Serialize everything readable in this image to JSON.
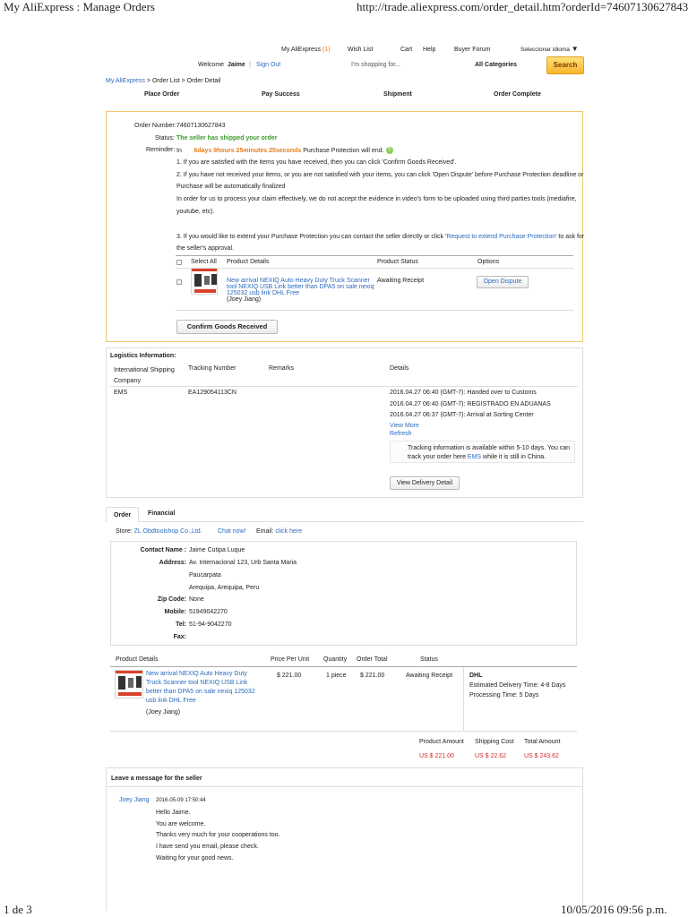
{
  "print": {
    "doc_title": "My AliExpress : Manage Orders",
    "url": "http://trade.aliexpress.com/order_detail.htm?orderId=74607130627843#...",
    "page": "1 de 3",
    "datetime": "10/05/2016 09:56 p.m."
  },
  "topnav": {
    "my_aliexpress": "My AliExpress",
    "count": "(1)",
    "wish_list": "Wish List",
    "cart": "Cart",
    "help": "Help",
    "buyer_forum": "Buyer Forum",
    "language": "Seleccionar idioma",
    "welcome": "Welcome",
    "user": "Jaime",
    "sign_out": "Sign Out",
    "search_placeholder": "I'm shopping for...",
    "categories": "All Categories",
    "search_btn": "Search"
  },
  "breadcrumb": {
    "root": "My AliExpress",
    "rest": " > Order List > Order Detail"
  },
  "steps": [
    "Place Order",
    "Pay Success",
    "Shipment",
    "Order Complete"
  ],
  "summary": {
    "order_number_label": "Order Number:",
    "order_number": "74607130627843",
    "status_label": "Status:",
    "status": "The seller has shipped your order",
    "reminder_label": "Reminder:",
    "reminder_in": "In",
    "countdown": "6days 9hours 25minutes 25seconds",
    "reminder_tail": "Purchase Protection will end.",
    "note1": "1. If you are satisfied with the items you have received, then you can click 'Confirm Goods Received'.",
    "note2a": "2. If you have not received your items, or you are not satisfied with your items, you can click 'Open Dispute' before Purchase Protection deadline or",
    "note2b": "Purchase will be automatically finalized",
    "note2c": "In order for us to process your claim effectively, we do not accept the evidence in video's form to be uploaded using third parties tools (mediafire,",
    "note2d": "youtube, etc).",
    "note3a": "3. If you would like to extend your Purchase Protection you can contact the seller directly or click '",
    "note3_link": "Request to extend Purchase Protection",
    "note3b": "' to ask for",
    "note3c": "the seller's approval.",
    "table": {
      "select_all": "Select All",
      "product_details": "Product Details",
      "product_status": "Product Status",
      "options": "Options"
    },
    "item": {
      "title1": "New arrival NEXIQ Auto Heavy Duty Truck Scanner",
      "title2": "tool NEXIQ USB Link better than DPA5 on sale nexiq",
      "title3": "125032 usb link DHL Free",
      "seller": "(Joey Jiang)",
      "status": "Awaiting Receipt",
      "dispute_btn": "Open Dispute"
    },
    "confirm_btn": "Confirm Goods Received"
  },
  "logistics": {
    "title": "Logistics Information:",
    "col_company1": "International Shipping",
    "col_company2": "Company",
    "col_tracking": "Tracking Number",
    "col_remarks": "Remarks",
    "col_details": "Details",
    "company": "EMS",
    "tracking": "EA129054113CN",
    "events": [
      "2016.04.27 06:40 (GMT-7): Handed over to Customs",
      "2016.04.27 06:40 (GMT-7): REGISTRADO EN ADUANAS",
      "2016.04.27 06:37 (GMT-7): Arrival at Sorting Center"
    ],
    "view_more": "View More",
    "refresh": "Refresh",
    "info1": "Tracking information is available within 5-10 days. You can",
    "info2a": "track your order here ",
    "info2_link": "EMS",
    "info2b": " while it is still in China.",
    "delivery_btn": "View Delivery Detail"
  },
  "tabs": {
    "order": "Order",
    "financial": "Financial"
  },
  "store": {
    "label": "Store:",
    "name": "ZL Obdtoolshop Co.,Ltd.",
    "chat": "Chat now!",
    "email_label": "Email:",
    "email_link": "click here"
  },
  "contact": {
    "name_label": "Contact Name :",
    "name": "Jaime Cutipa Luque",
    "address_label": "Address:",
    "address1": "Av. Internacional 123, Urb Santa Maria",
    "address2": "Paucarpata",
    "address3": "Arequipa, Arequipa, Peru",
    "zip_label": "Zip Code:",
    "zip": "None",
    "mobile_label": "Mobile:",
    "mobile": "51949042270",
    "tel_label": "Tel:",
    "tel": "51-94-9042270",
    "fax_label": "Fax:",
    "fax": ""
  },
  "details": {
    "col_product": "Product Details",
    "col_price": "Price Per Unit",
    "col_qty": "Quantity",
    "col_total": "Order Total",
    "col_status": "Status",
    "title1": "New arrival NEXIQ Auto Heavy Duty",
    "title2": "Truck Scanner tool NEXIQ USB Link",
    "title3": "better than DPA5 on sale nexiq 125032",
    "title4": "usb link DHL Free",
    "seller": "(Joey Jiang)",
    "price": "$ 221.00",
    "qty": "1 piece",
    "total": "$ 221.00",
    "status": "Awaiting Receipt",
    "carrier": "DHL",
    "delivery": "Estimated Delivery Time: 4-8 Days",
    "processing": "Processing Time: 5 Days",
    "product_amount_label": "Product Amount",
    "shipping_cost_label": "Shipping Cost",
    "total_amount_label": "Total Amount",
    "product_amount": "US $ 221.00",
    "shipping_cost": "US $ 22.62",
    "total_amount": "US $ 243.62"
  },
  "message": {
    "title": "Leave a message for the seller",
    "author": "Joey Jiang",
    "time": "2016-05-09 17:50:44",
    "lines": [
      "Hello Jaime.",
      "You are welcome.",
      "Thanks very much for your cooperations too.",
      "I have send you email, please check.",
      "Waiting for your good news."
    ]
  }
}
